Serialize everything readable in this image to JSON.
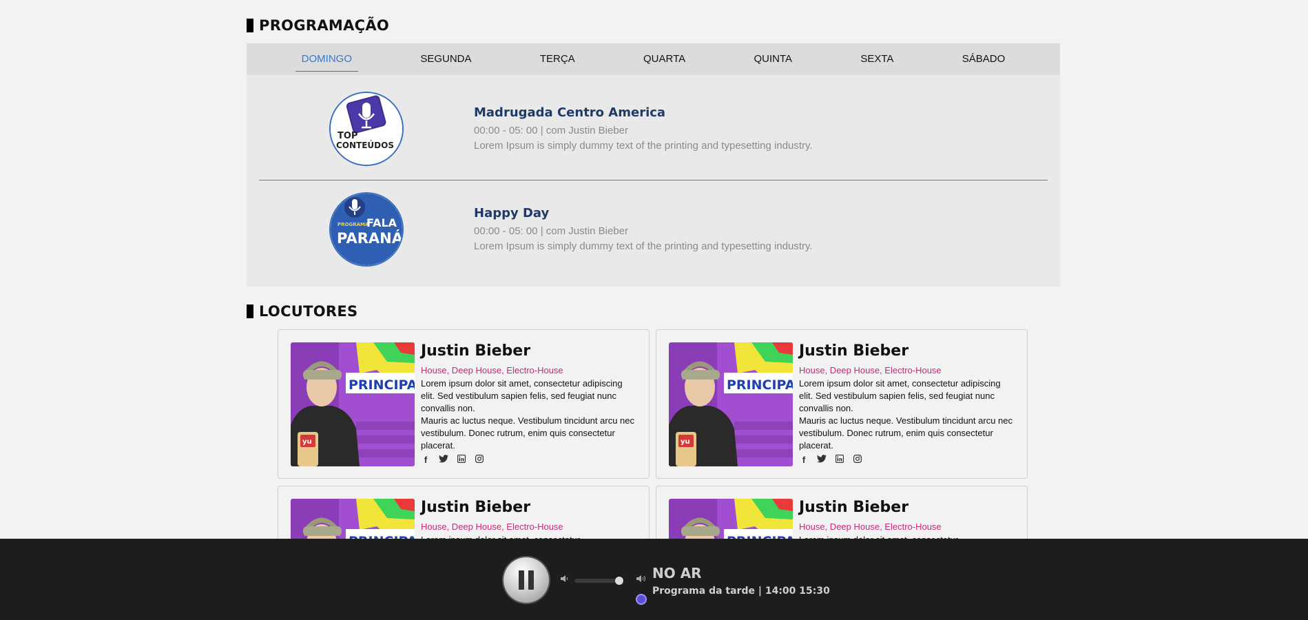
{
  "schedule": {
    "title": "PROGRAMAÇÃO",
    "tabs": [
      "DOMINGO",
      "SEGUNDA",
      "TERÇA",
      "QUARTA",
      "QUINTA",
      "SEXTA",
      "SÁBADO"
    ],
    "active_tab": "DOMINGO",
    "shows": [
      {
        "title": "Madrugada Centro America",
        "time": "00:00 - 05: 00 | com Justin Bieber",
        "desc": "Lorem Ipsum is simply dummy text of the printing and typesetting industry.",
        "logo_top": "TOP",
        "logo_bottom": "CONTEÚDOS"
      },
      {
        "title": "Happy Day",
        "time": "00:00 - 05: 00 | com Justin Bieber",
        "desc": "Lorem Ipsum is simply dummy text of the printing and typesetting industry.",
        "logo_small": "PROGRAMA",
        "logo_top": "FALA",
        "logo_bottom": "PARANÁ"
      }
    ]
  },
  "hosts": {
    "title": "LOCUTORES",
    "cards": [
      {
        "name": "Justin Bieber",
        "genre": "House, Deep House, Electro-House",
        "bio1": "Lorem ipsum dolor sit amet, consectetur adipiscing elit. Sed vestibulum sapien felis, sed feugiat nunc convallis non.",
        "bio2": "Mauris ac luctus neque. Vestibulum tincidunt arcu nec vestibulum. Donec rutrum, enim quis consectetur placerat.",
        "photo_banner": "PRINCIPA",
        "mic_label": "yu"
      },
      {
        "name": "Justin Bieber",
        "genre": "House, Deep House, Electro-House",
        "bio1": "Lorem ipsum dolor sit amet, consectetur adipiscing elit. Sed vestibulum sapien felis, sed feugiat nunc convallis non.",
        "bio2": "Mauris ac luctus neque. Vestibulum tincidunt arcu nec vestibulum. Donec rutrum, enim quis consectetur placerat.",
        "photo_banner": "PRINCIPA",
        "mic_label": "yu"
      },
      {
        "name": "Justin Bieber",
        "genre": "House, Deep House, Electro-House",
        "bio1": "Lorem ipsum dolor sit amet, consectetur",
        "bio2": "",
        "photo_banner": "PRINCIPA",
        "mic_label": ""
      },
      {
        "name": "Justin Bieber",
        "genre": "House, Deep House, Electro-House",
        "bio1": "Lorem ipsum dolor sit amet, consectetur",
        "bio2": "",
        "photo_banner": "PRINCIPA",
        "mic_label": ""
      }
    ],
    "social_icons": [
      "facebook-icon",
      "twitter-icon",
      "linkedin-icon",
      "instagram-icon"
    ]
  },
  "player": {
    "status": "NO AR",
    "program": "Programa da tarde | 14:00 15:30",
    "volume": 0.9,
    "state": "playing"
  }
}
